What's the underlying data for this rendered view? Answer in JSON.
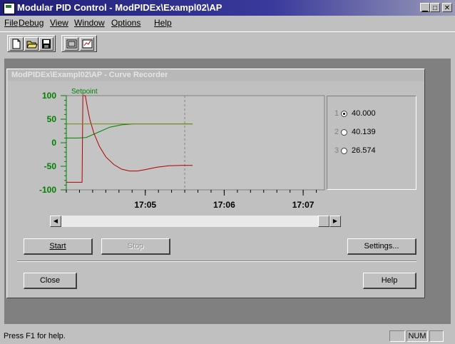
{
  "window": {
    "title": "Modular PID Control - ModPIDEx\\Exampl02\\AP",
    "buttons": [
      "minimize",
      "maximize",
      "close"
    ]
  },
  "menu": [
    {
      "label": "File"
    },
    {
      "label": "Debug"
    },
    {
      "label": "View"
    },
    {
      "label": "Window"
    },
    {
      "label": "Options"
    },
    {
      "label": "Help"
    }
  ],
  "toolbar": {
    "icons": [
      "new-file-icon",
      "open-folder-icon",
      "save-disk-icon",
      "recorder-view-icon",
      "chart-view-icon"
    ]
  },
  "child": {
    "title": "ModPIDEx\\Exampl02\\AP - Curve Recorder"
  },
  "chart_data": {
    "type": "line",
    "setpoint_label": "Setpoint",
    "ylim": [
      -100,
      100
    ],
    "yticks": [
      "100",
      "50",
      "0",
      "-50",
      "-100"
    ],
    "xticks": [
      "17:05",
      "17:06",
      "17:07"
    ],
    "x_range_minutes": [
      0,
      3.27
    ],
    "cursor_x": 1.5,
    "colors": {
      "axis": "#008000",
      "setpoint": "#008000",
      "process": "#b00000",
      "output": "#7a8a10"
    },
    "series": [
      {
        "points": [
          [
            0,
            10
          ],
          [
            0.15,
            10
          ],
          [
            0.25,
            11
          ],
          [
            0.4,
            22
          ],
          [
            0.55,
            33
          ],
          [
            0.7,
            38
          ],
          [
            0.85,
            40
          ],
          [
            1.0,
            40
          ],
          [
            1.3,
            40
          ],
          [
            1.6,
            40
          ]
        ]
      },
      {
        "points": [
          [
            0,
            -84
          ],
          [
            0.2,
            -84
          ],
          [
            0.21,
            100
          ],
          [
            0.24,
            100
          ],
          [
            0.27,
            72
          ],
          [
            0.3,
            48
          ],
          [
            0.35,
            20
          ],
          [
            0.42,
            -8
          ],
          [
            0.5,
            -30
          ],
          [
            0.6,
            -46
          ],
          [
            0.7,
            -56
          ],
          [
            0.8,
            -60
          ],
          [
            0.9,
            -60
          ],
          [
            1.0,
            -57
          ],
          [
            1.15,
            -52
          ],
          [
            1.3,
            -49
          ],
          [
            1.45,
            -48
          ],
          [
            1.6,
            -48
          ]
        ]
      },
      {
        "points": [
          [
            0,
            40
          ],
          [
            1.6,
            40
          ]
        ]
      }
    ]
  },
  "channels": [
    {
      "number": "1",
      "value": "40.000",
      "selected": true
    },
    {
      "number": "2",
      "value": "40.139",
      "selected": false
    },
    {
      "number": "3",
      "value": "26.574",
      "selected": false
    }
  ],
  "buttons": {
    "start": "Start",
    "stop": "Stop",
    "settings": "Settings...",
    "close": "Close",
    "help": "Help"
  },
  "status": {
    "message": "Press F1 for help.",
    "num": "NUM"
  }
}
